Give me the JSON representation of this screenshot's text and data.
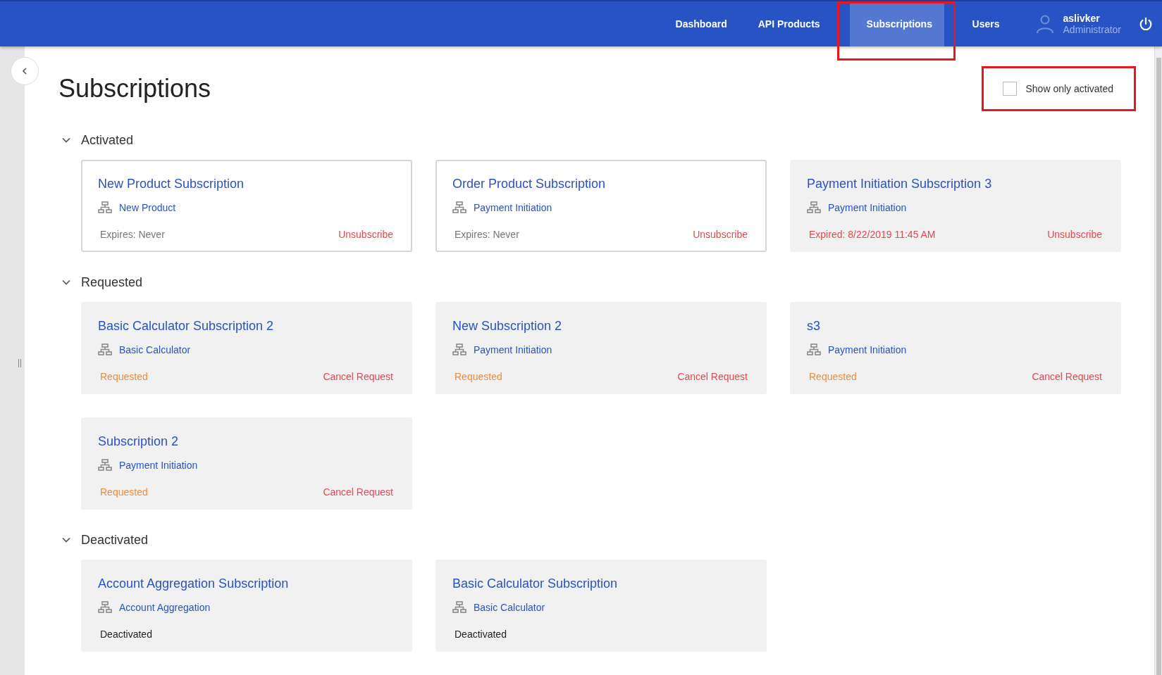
{
  "nav": {
    "items": [
      {
        "label": "Dashboard",
        "selected": false,
        "annotated": false
      },
      {
        "label": "API Products",
        "selected": false,
        "annotated": false
      },
      {
        "label": "Subscriptions",
        "selected": true,
        "annotated": true
      },
      {
        "label": "Users",
        "selected": false,
        "annotated": false
      }
    ],
    "user": {
      "name": "aslivker",
      "role": "Administrator"
    }
  },
  "page": {
    "title": "Subscriptions",
    "filter": {
      "label": "Show only activated",
      "checked": false,
      "annotated": true
    }
  },
  "groups": [
    {
      "title": "Activated",
      "expanded": true,
      "cards": [
        {
          "title": "New Product Subscription",
          "product": "New Product",
          "kind": "active",
          "status": "Expires: Never",
          "action": "Unsubscribe"
        },
        {
          "title": "Order Product Subscription",
          "product": "Payment Initiation",
          "kind": "active",
          "status": "Expires: Never",
          "action": "Unsubscribe"
        },
        {
          "title": "Payment Initiation Subscription 3",
          "product": "Payment Initiation",
          "kind": "expired",
          "status": "Expired: 8/22/2019 11:45 AM",
          "action": "Unsubscribe"
        }
      ]
    },
    {
      "title": "Requested",
      "expanded": true,
      "cards": [
        {
          "title": "Basic Calculator Subscription 2",
          "product": "Basic Calculator",
          "kind": "requested",
          "status": "Requested",
          "action": "Cancel Request"
        },
        {
          "title": "New Subscription 2",
          "product": "Payment Initiation",
          "kind": "requested",
          "status": "Requested",
          "action": "Cancel Request"
        },
        {
          "title": "s3",
          "product": "Payment Initiation",
          "kind": "requested",
          "status": "Requested",
          "action": "Cancel Request"
        },
        {
          "title": "Subscription 2",
          "product": "Payment Initiation",
          "kind": "requested",
          "status": "Requested",
          "action": "Cancel Request"
        }
      ]
    },
    {
      "title": "Deactivated",
      "expanded": true,
      "cards": [
        {
          "title": "Account Aggregation Subscription",
          "product": "Account Aggregation",
          "kind": "deactivated",
          "status": "Deactivated"
        },
        {
          "title": "Basic Calculator Subscription",
          "product": "Basic Calculator",
          "kind": "deactivated",
          "status": "Deactivated"
        }
      ]
    }
  ]
}
